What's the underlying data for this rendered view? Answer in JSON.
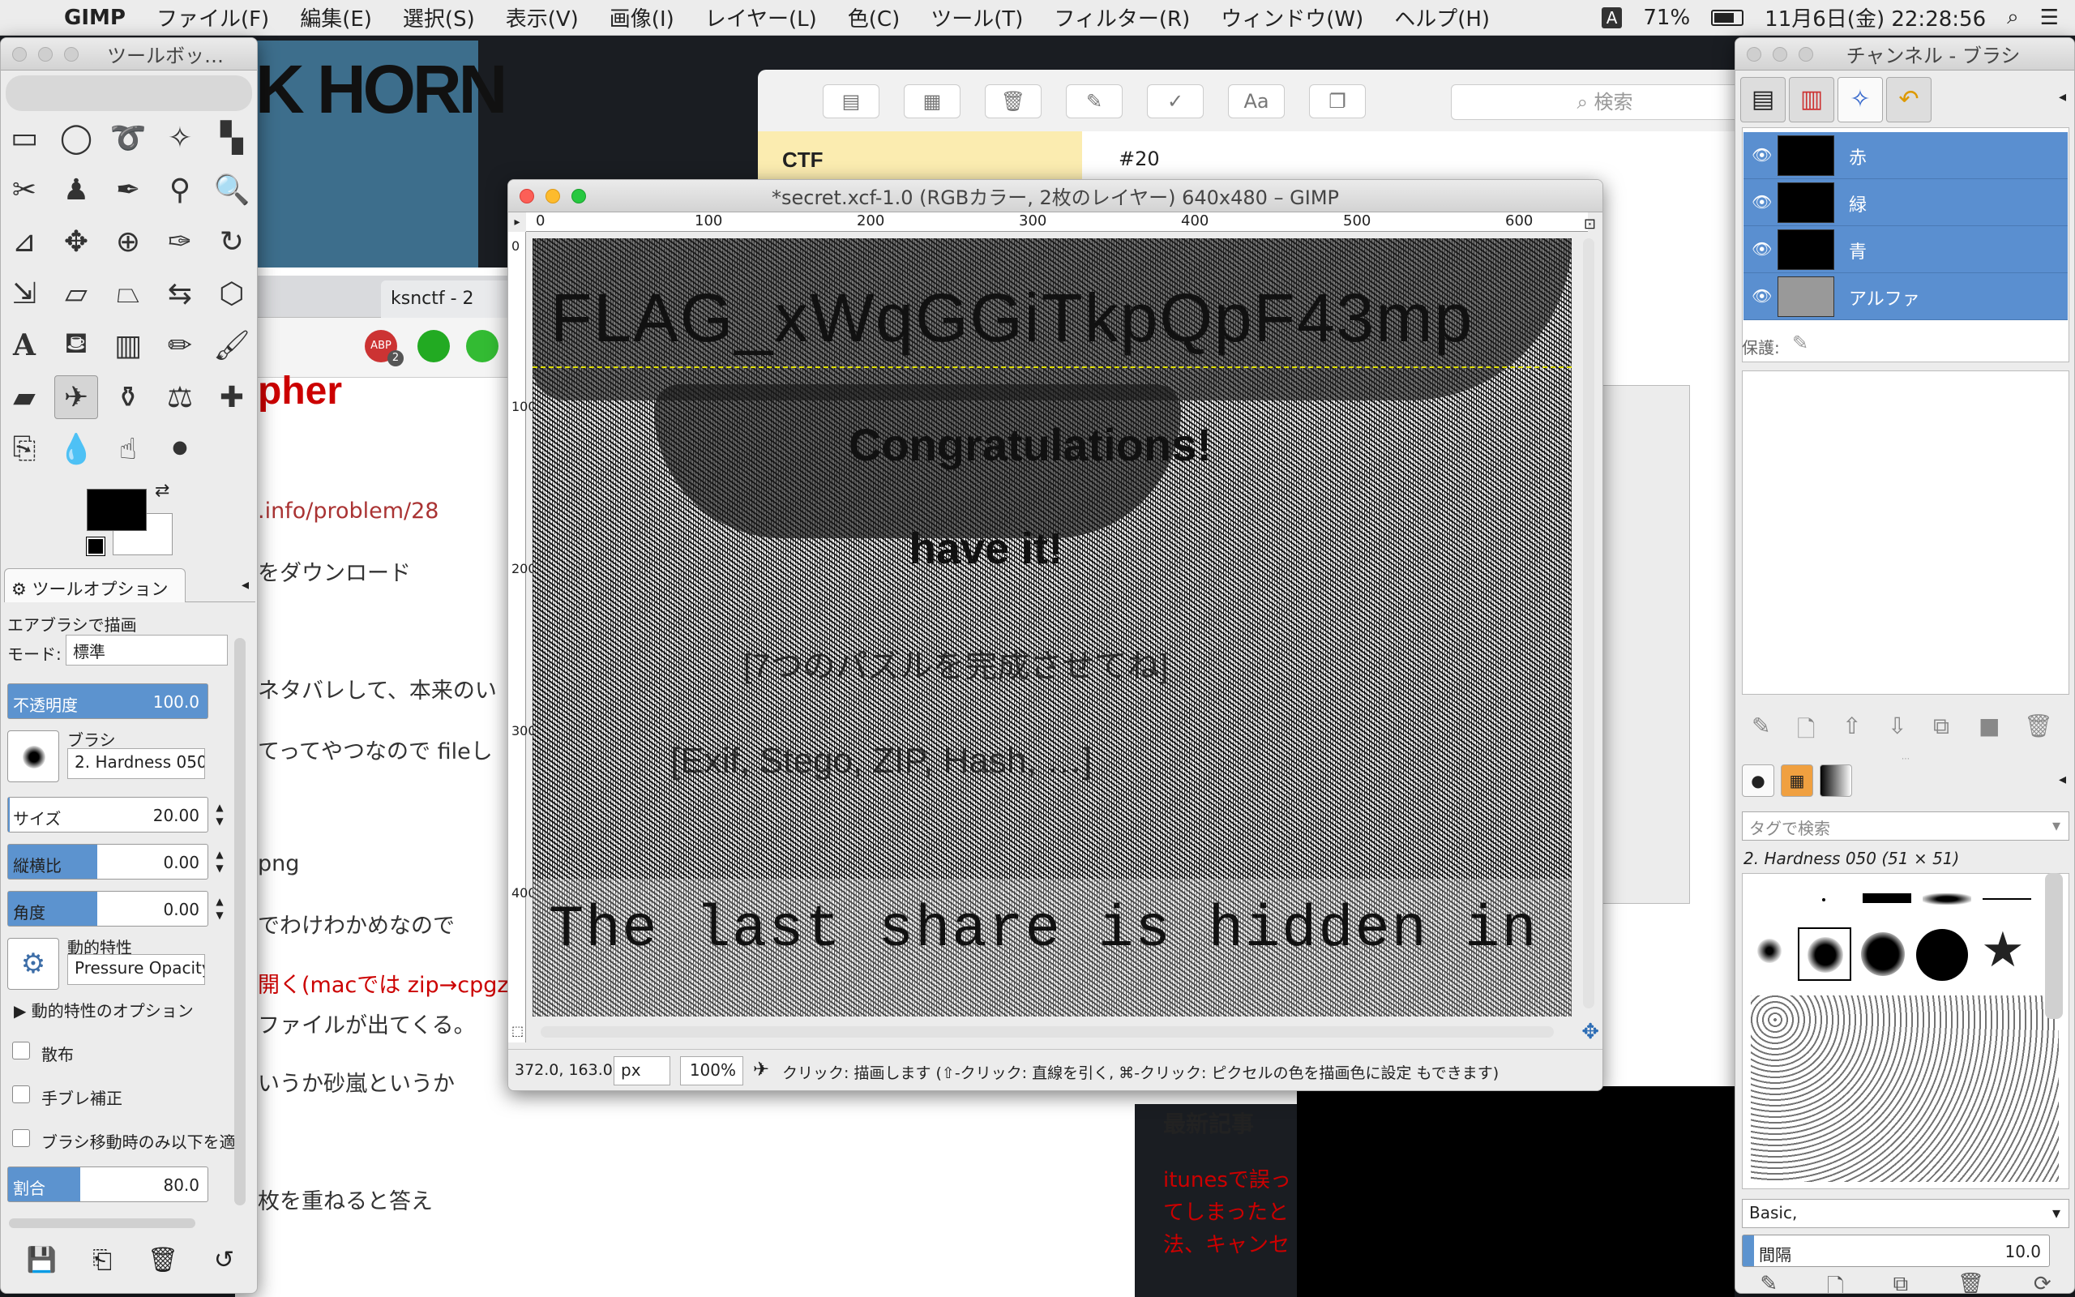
{
  "menubar": {
    "app": "GIMP",
    "items": [
      "ファイル(F)",
      "編集(E)",
      "選択(S)",
      "表示(V)",
      "画像(I)",
      "レイヤー(L)",
      "色(C)",
      "ツール(T)",
      "フィルター(R)",
      "ウィンドウ(W)",
      "ヘルプ(H)"
    ],
    "ime": "A",
    "battery": "71%",
    "clock": "11月6日(金) 22:28:56"
  },
  "background": {
    "logo_text": "K HORN",
    "tab_label": "ksnctf - 2",
    "abp_badge": "2",
    "heading": "pher",
    "link": ".info/problem/28",
    "lines": [
      "をダウンロード",
      "ネタバレして、本来のい",
      "てってやつなので fileし",
      "png",
      "でわけわかめなので",
      "ファイルが出てくる。",
      "いうか砂嵐というか",
      "枚を重ねると答え"
    ],
    "line_red": "開く(macでは zip→cpgz→",
    "notes_side": "CTF",
    "notes_title": "#20",
    "notes_search": "検索",
    "sidebar_heading": "最新記事",
    "sidebar_links": [
      "itunesで誤っ",
      "てしまったと",
      "法、キャンセ"
    ]
  },
  "toolbox": {
    "title": "ツールボッ…",
    "options_tab": "ツールオプション",
    "tool_name": "エアブラシで描画",
    "mode_label": "モード:",
    "mode_value": "標準",
    "opacity_label": "不透明度",
    "opacity_value": "100.0",
    "brush_label": "ブラシ",
    "brush_value": "2. Hardness 050",
    "size_label": "サイズ",
    "size_value": "20.00",
    "aspect_label": "縦横比",
    "aspect_value": "0.00",
    "angle_label": "角度",
    "angle_value": "0.00",
    "dynamics_label": "動的特性",
    "dynamics_value": "Pressure Opacity",
    "dynamics_options": "動的特性のオプション",
    "scatter": "散布",
    "smooth": "手ブレ補正",
    "motion_only": "ブラシ移動時のみ以下を適",
    "rate_label": "割合",
    "rate_value": "80.0",
    "opacity_fill": 1.0,
    "rate_fill": 0.8
  },
  "image_window": {
    "title": "*secret.xcf-1.0 (RGBカラー, 2枚のレイヤー) 640x480 – GIMP",
    "ruler_h": [
      "0",
      "100",
      "200",
      "300",
      "400",
      "500",
      "600"
    ],
    "ruler_v": [
      "0",
      "100",
      "200",
      "300",
      "400"
    ],
    "canvas_text": {
      "flag": "FLAG_xWqGGiTkpQpF43mp",
      "congrats": "Congratulations!",
      "have_it": "have it!",
      "line_a": "[7つのパズルを完成させてね]",
      "line_b": "[Exif, Stego, ZIP, Hash, …]",
      "last": "The last share is hidden in the ZIP"
    },
    "coords": "372.0, 163.0",
    "unit": "px",
    "zoom": "100%",
    "status": "クリック: 描画します (⇧-クリック: 直線を引く, ⌘-クリック: ピクセルの色を描画色に設定 もできます)"
  },
  "channels": {
    "title": "チャンネル - ブラシ",
    "rows": [
      {
        "name": "赤"
      },
      {
        "name": "緑"
      },
      {
        "name": "青"
      },
      {
        "name": "アルファ"
      }
    ],
    "lock_label": "保護:",
    "tag_search": "タグで検索",
    "brush_name": "2. Hardness 050 (51 × 51)",
    "preset": "Basic,",
    "spacing_label": "間隔",
    "spacing_value": "10.0"
  },
  "colors": {
    "selection": "#5a8fd0",
    "link_red": "#cc0000"
  }
}
